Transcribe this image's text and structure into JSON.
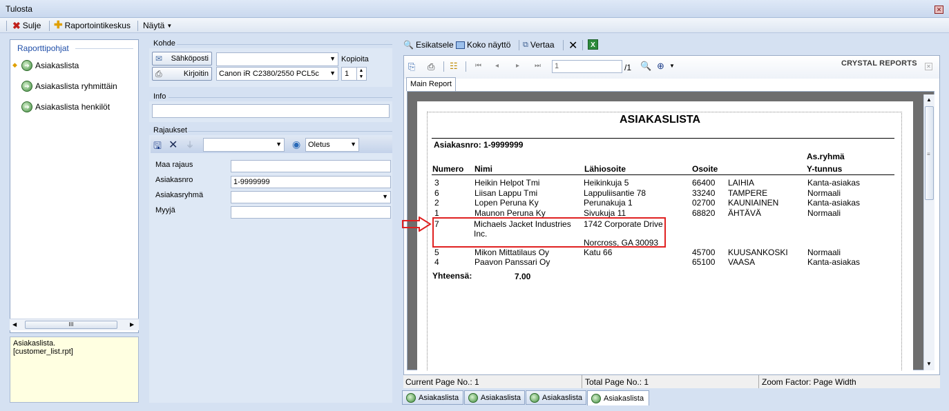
{
  "window": {
    "title": "Tulosta",
    "close_icon": "close-icon"
  },
  "toolbar": {
    "close_label": "Sulje",
    "report_center_label": "Raportointikeskus",
    "view_label": "Näytä"
  },
  "templates": {
    "header": "Raporttipohjat",
    "items": [
      {
        "label": "Asiakaslista"
      },
      {
        "label": "Asiakaslista ryhmittäin"
      },
      {
        "label": "Asiakaslista henkilöt"
      }
    ],
    "scroll_thumb": "III",
    "description": "Asiakaslista.\n[customer_list.rpt]"
  },
  "target": {
    "title": "Kohde",
    "email_button": "Sähköposti",
    "printer_button": "Kirjoitin",
    "email_combo_value": "",
    "printer_combo_value": "Canon iR C2380/2550 PCL5c",
    "copies_label": "Kopioita",
    "copies_value": "1"
  },
  "info": {
    "title": "Info",
    "value": ""
  },
  "filters": {
    "title": "Rajaukset",
    "preset_value": "Oletus",
    "rows": [
      {
        "label": "Maa rajaus",
        "value": ""
      },
      {
        "label": "Asiakasnro",
        "value": "1-9999999"
      },
      {
        "label": "Asiakasryhmä",
        "value": ""
      },
      {
        "label": "Myyjä",
        "value": ""
      }
    ]
  },
  "report_toolbar": {
    "preview_label": "Esikatsele",
    "fullscreen_label": "Koko näyttö",
    "compare_label": "Vertaa"
  },
  "crystal": {
    "brand": "CRYSTAL REPORTS",
    "page_input": "1",
    "page_total": "/1",
    "main_tab": "Main Report"
  },
  "report": {
    "title": "ASIAKASLISTA",
    "range": "Asiakasnro: 1-9999999",
    "columns": {
      "numero": "Numero",
      "nimi": "Nimi",
      "lahiosoite": "Lähiosoite",
      "osoite": "Osoite",
      "group_top": "As.ryhmä",
      "group_bottom": "Y-tunnus"
    },
    "rows": [
      {
        "no": "3",
        "name": "Heikin Helpot Tmi",
        "street": "Heikinkuja 5",
        "zip": "66400",
        "city": "LAIHIA",
        "group": "Kanta-asiakas"
      },
      {
        "no": "6",
        "name": "Liisan Lappu Tmi",
        "street": "Lappuliisantie 78",
        "zip": "33240",
        "city": "TAMPERE",
        "group": "Normaali"
      },
      {
        "no": "2",
        "name": "Lopen Peruna Ky",
        "street": "Perunakuja 1",
        "zip": "02700",
        "city": "KAUNIAINEN",
        "group": "Kanta-asiakas"
      },
      {
        "no": "1",
        "name": "Maunon Peruna Ky",
        "street": "Sivukuja 11",
        "zip": "68820",
        "city": "ÄHTÄVÄ",
        "group": "Normaali"
      },
      {
        "no": "7",
        "name": "Michaels Jacket Industries",
        "name2": "Inc.",
        "street": "1742 Corporate Drive",
        "street2": "Norcross, GA 30093",
        "zip": "",
        "city": "",
        "group": ""
      },
      {
        "no": "5",
        "name": "Mikon Mittatilaus Oy",
        "street": "Katu 66",
        "zip": "45700",
        "city": "KUUSANKOSKI",
        "group": "Normaali"
      },
      {
        "no": "4",
        "name": "Paavon Panssari Oy",
        "street": "",
        "zip": "65100",
        "city": "VAASA",
        "group": "Kanta-asiakas"
      }
    ],
    "total_label": "Yhteensä:",
    "total_value": "7.00"
  },
  "status": {
    "current": "Current Page No.: 1",
    "total": "Total Page No.: 1",
    "zoom": "Zoom Factor: Page Width"
  },
  "bottom_tabs": [
    "Asiakaslista",
    "Asiakaslista",
    "Asiakaslista",
    "Asiakaslista"
  ],
  "colors": {
    "highlight": "#e02020",
    "link": "#1f4ea8"
  }
}
